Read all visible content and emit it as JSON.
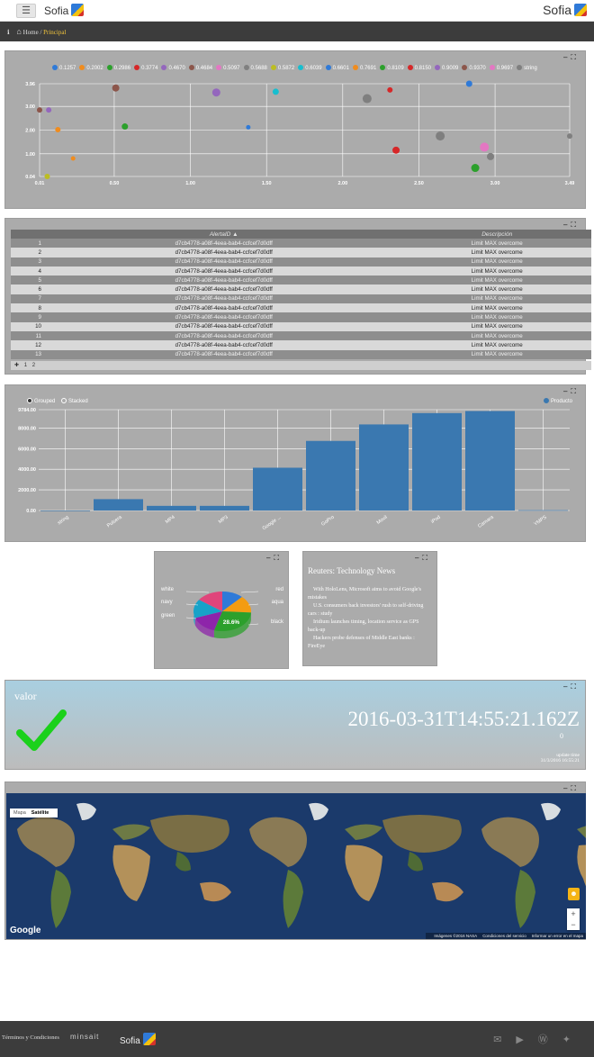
{
  "header": {
    "menu_icon": "menu-icon",
    "brand": "Sofia",
    "brand_right": "Sofia"
  },
  "breadcrumb": {
    "home": "Home",
    "separator": " / ",
    "current": "Principal"
  },
  "scatter": {
    "legend": [
      "0.1257",
      "0.2002",
      "0.2986",
      "0.3774",
      "0.4670",
      "0.4684",
      "0.5097",
      "0.5688",
      "0.5872",
      "0.6039",
      "0.6601",
      "0.7691",
      "0.8109",
      "0.8150",
      "0.9009",
      "0.9370",
      "0.9697",
      "string"
    ],
    "colors": [
      "#2f7ad8",
      "#f08c1e",
      "#2ca02c",
      "#d62728",
      "#9467bd",
      "#8c564b",
      "#e377c2",
      "#7f7f7f",
      "#bcbd22",
      "#17becf",
      "#2f7ad8",
      "#f08c1e",
      "#2ca02c",
      "#d62728",
      "#9467bd",
      "#8c564b",
      "#e377c2",
      "#7f7f7f"
    ]
  },
  "chart_data": [
    {
      "type": "scatter",
      "title": "",
      "xlim": [
        0.01,
        3.49
      ],
      "ylim": [
        0.04,
        3.96
      ],
      "x_ticks": [
        "0.01",
        "0.50",
        "1.00",
        "1.50",
        "2.00",
        "2.50",
        "3.00",
        "3.49"
      ],
      "y_ticks": [
        "0.04",
        "1.00",
        "2.00",
        "3.00",
        "3.96"
      ],
      "points": [
        {
          "x": 0.01,
          "y": 2.85,
          "size": 3,
          "color": "#8c564b"
        },
        {
          "x": 0.07,
          "y": 2.85,
          "size": 3,
          "color": "#9467bd"
        },
        {
          "x": 0.06,
          "y": 0.04,
          "size": 3,
          "color": "#bcbd22"
        },
        {
          "x": 0.13,
          "y": 2.02,
          "size": 3,
          "color": "#f08c1e"
        },
        {
          "x": 0.23,
          "y": 0.8,
          "size": 2.5,
          "color": "#f08c1e"
        },
        {
          "x": 0.51,
          "y": 3.78,
          "size": 4,
          "color": "#8c564b"
        },
        {
          "x": 0.57,
          "y": 2.15,
          "size": 3.5,
          "color": "#2ca02c"
        },
        {
          "x": 1.17,
          "y": 3.59,
          "size": 4.5,
          "color": "#9467bd"
        },
        {
          "x": 1.38,
          "y": 2.12,
          "size": 2.5,
          "color": "#2f7ad8"
        },
        {
          "x": 1.56,
          "y": 3.62,
          "size": 3.5,
          "color": "#17becf"
        },
        {
          "x": 2.16,
          "y": 3.33,
          "size": 5,
          "color": "#7f7f7f"
        },
        {
          "x": 2.31,
          "y": 3.7,
          "size": 3,
          "color": "#d62728"
        },
        {
          "x": 2.35,
          "y": 1.15,
          "size": 4,
          "color": "#d62728"
        },
        {
          "x": 2.64,
          "y": 1.75,
          "size": 5,
          "color": "#7f7f7f"
        },
        {
          "x": 2.83,
          "y": 3.96,
          "size": 3.5,
          "color": "#2f7ad8"
        },
        {
          "x": 2.87,
          "y": 0.4,
          "size": 4.5,
          "color": "#2ca02c"
        },
        {
          "x": 2.93,
          "y": 1.28,
          "size": 5,
          "color": "#e377c2"
        },
        {
          "x": 2.97,
          "y": 0.88,
          "size": 4,
          "color": "#7f7f7f"
        },
        {
          "x": 3.49,
          "y": 1.75,
          "size": 3,
          "color": "#7f7f7f"
        }
      ]
    },
    {
      "type": "bar",
      "title": "",
      "series": [
        {
          "name": "Producto",
          "values": [
            0,
            1100,
            450,
            450,
            4150,
            6750,
            8350,
            9450,
            9650,
            30
          ]
        }
      ],
      "categories": [
        "string",
        "Pulsera",
        "MP4",
        "MP3",
        "Google ...",
        "GoPro",
        "Movil",
        "iPod",
        "Camara",
        "YMPS"
      ],
      "ylim": [
        0,
        9784
      ],
      "y_ticks": [
        "0.00",
        "2000.00",
        "4000.00",
        "6000.00",
        "8000.00",
        "9784.00"
      ],
      "controls": {
        "grouped": "Grouped",
        "stacked": "Stacked"
      },
      "color": "#3a78b0"
    },
    {
      "type": "pie",
      "title": "",
      "slices": [
        {
          "name": "red",
          "value": 12,
          "color": "#2f7ad8"
        },
        {
          "name": "aqua",
          "value": 14,
          "color": "#f39c12"
        },
        {
          "name": "black",
          "value": 28.6,
          "color": "#2ca02c"
        },
        {
          "name": "green",
          "value": 15,
          "color": "#8e24aa"
        },
        {
          "name": "navy",
          "value": 15.4,
          "color": "#17a2c8"
        },
        {
          "name": "white",
          "value": 15,
          "color": "#e0457b"
        }
      ],
      "center_label": "28.6%"
    }
  ],
  "table": {
    "columns": [
      "",
      "AlertaID ▲",
      "Descripción"
    ],
    "rows": [
      [
        "1",
        "d7cb4778-a08f-4eea-bab4-ccfcef7d0dff",
        "Limit MAX overcome"
      ],
      [
        "2",
        "d7cb4778-a08f-4eea-bab4-ccfcef7d0dff",
        "Limit MAX overcome"
      ],
      [
        "3",
        "d7cb4778-a08f-4eea-bab4-ccfcef7d0dff",
        "Limit MAX overcome"
      ],
      [
        "4",
        "d7cb4778-a08f-4eea-bab4-ccfcef7d0dff",
        "Limit MAX overcome"
      ],
      [
        "5",
        "d7cb4778-a08f-4eea-bab4-ccfcef7d0dff",
        "Limit MAX overcome"
      ],
      [
        "6",
        "d7cb4778-a08f-4eea-bab4-ccfcef7d0dff",
        "Limit MAX overcome"
      ],
      [
        "7",
        "d7cb4778-a08f-4eea-bab4-ccfcef7d0dff",
        "Limit MAX overcome"
      ],
      [
        "8",
        "d7cb4778-a08f-4eea-bab4-ccfcef7d0dff",
        "Limit MAX overcome"
      ],
      [
        "9",
        "d7cb4778-a08f-4eea-bab4-ccfcef7d0dff",
        "Limit MAX overcome"
      ],
      [
        "10",
        "d7cb4778-a08f-4eea-bab4-ccfcef7d0dff",
        "Limit MAX overcome"
      ],
      [
        "11",
        "d7cb4778-a08f-4eea-bab4-ccfcef7d0dff",
        "Limit MAX overcome"
      ],
      [
        "12",
        "d7cb4778-a08f-4eea-bab4-ccfcef7d0dff",
        "Limit MAX overcome"
      ],
      [
        "13",
        "d7cb4778-a08f-4eea-bab4-ccfcef7d0dff",
        "Limit MAX overcome"
      ]
    ],
    "pager": {
      "current": "1",
      "next": "2"
    }
  },
  "news": {
    "title": "Reuters: Technology News",
    "items": [
      "With HoloLens, Microsoft aims to avoid Google's mistakes",
      "U.S. consumers back investors' rush to self-driving cars : study",
      "Iridium launches timing, location service as GPS back-up",
      "Hackers probe defenses of Middle East banks : FireEye"
    ]
  },
  "status": {
    "label": "valor",
    "timestamp": "2016-03-31T14:55:21.162Z",
    "count": "0",
    "update_label": "update time",
    "update_value": "31/3/2016 16:55:21"
  },
  "map": {
    "types": [
      "Mapa",
      "Satélite"
    ],
    "google": "Google",
    "attribution": [
      "Imágenes ©2016 NASA",
      "Condiciones del servicio",
      "Informar un error en el mapa"
    ]
  },
  "footer": {
    "terms": "Términos y Condiciones",
    "minsait": "minsait",
    "sofia": "Sofia",
    "social_icons": [
      "mail-icon",
      "youtube-icon",
      "wordpress-icon",
      "twitter-icon"
    ]
  }
}
